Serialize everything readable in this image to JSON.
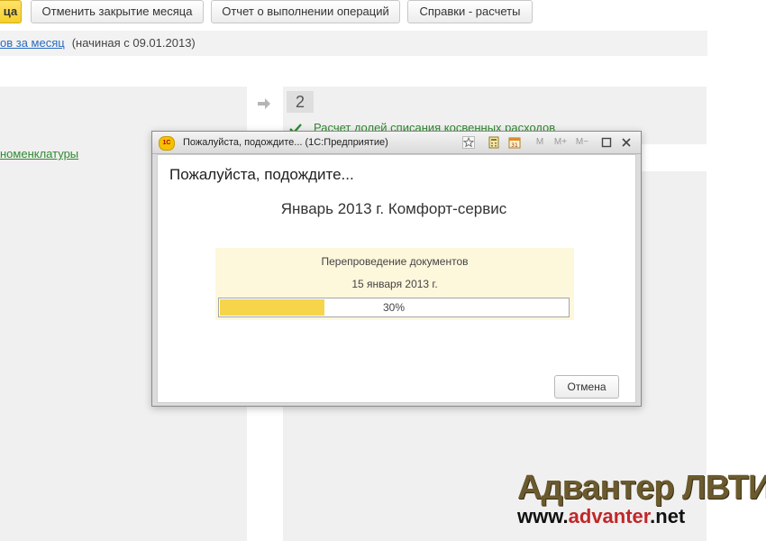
{
  "toolbar": {
    "close_month_partial": "ца",
    "cancel_close_month": "Отменить закрытие месяца",
    "operations_report": "Отчет о выполнении операций",
    "help_calc": "Справки - расчеты"
  },
  "info_strip": {
    "link_text": "ов за месяц",
    "start_text": "(начиная с 09.01.2013)"
  },
  "left_pane": {
    "link_text": "номенклатуры"
  },
  "step": {
    "number": "2",
    "item_text": "Расчет долей списания косвенных расходов"
  },
  "dialog": {
    "title": "Пожалуйста, подождите... (1С:Предприятие)",
    "heading": "Пожалуйста, подождите...",
    "subtitle": "Январь 2013 г. Комфорт-сервис",
    "progress_label": "Перепроведение документов",
    "progress_date": "15 января 2013 г.",
    "progress_value": 0.3,
    "progress_text": "30%",
    "cancel_label": "Отмена",
    "titlebar_buttons": [
      "M",
      "M+",
      "M-"
    ]
  },
  "watermark": {
    "brand": "Адвантер ЛВТИ",
    "url_prefix": "www.",
    "url_highlight": "advanter",
    "url_suffix": ".net"
  },
  "colors": {
    "accent_yellow": "#f5cf2a",
    "progress_fill": "#f6d54a",
    "link_green": "#2f8a2f",
    "link_blue": "#2a6bbf"
  }
}
